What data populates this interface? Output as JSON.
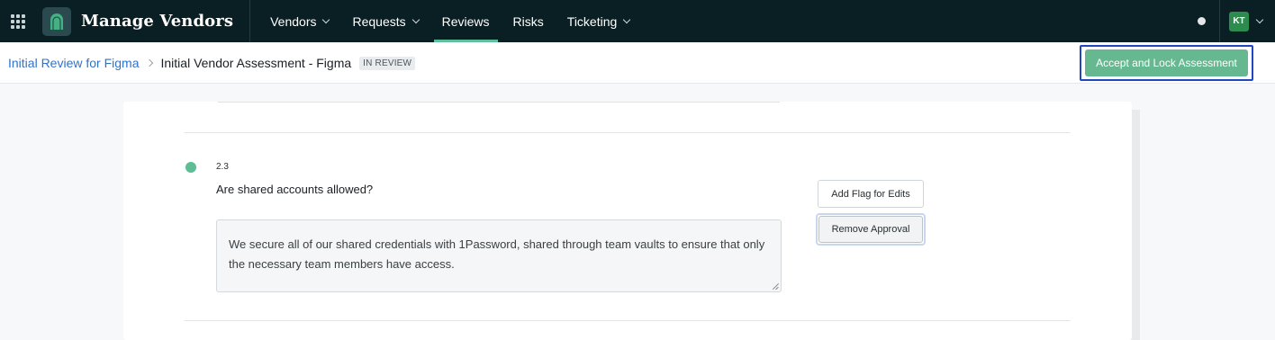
{
  "app": {
    "title": "Manage Vendors"
  },
  "nav": {
    "items": [
      {
        "label": "Vendors",
        "dropdown": true
      },
      {
        "label": "Requests",
        "dropdown": true
      },
      {
        "label": "Reviews",
        "dropdown": false,
        "active": true
      },
      {
        "label": "Risks",
        "dropdown": false
      },
      {
        "label": "Ticketing",
        "dropdown": true
      }
    ],
    "user_initials": "KT",
    "icons": [
      "apps-grid-icon",
      "logo-icon",
      "status-dot-icon",
      "chevron-down-icon"
    ]
  },
  "breadcrumb": {
    "parent": "Initial Review for Figma",
    "current": "Initial Vendor Assessment - Figma",
    "status_badge": "IN REVIEW"
  },
  "actions": {
    "accept_label": "Accept and Lock Assessment"
  },
  "question": {
    "number": "2.3",
    "text": "Are shared accounts allowed?",
    "answer": "We secure all of our shared credentials with 1Password, shared through team vaults to ensure that only the necessary team members have access.",
    "flag_label": "Add Flag for Edits",
    "remove_label": "Remove Approval",
    "status_color": "#5dbd95"
  },
  "colors": {
    "nav_bg": "#0a1f24",
    "accent": "#5fbf9c",
    "link": "#2f73c9",
    "accept_button": "#66b890"
  }
}
